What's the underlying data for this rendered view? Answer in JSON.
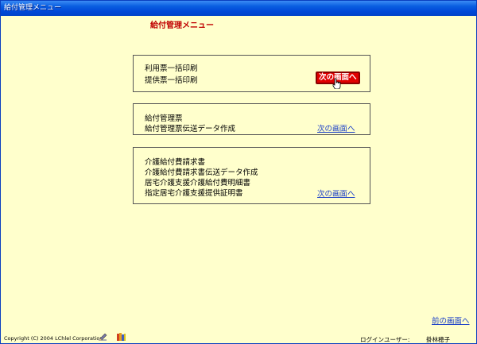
{
  "window": {
    "title": "給付管理メニュー"
  },
  "heading": "給付管理メニュー",
  "panels": [
    {
      "items": [
        "利用票一括印刷",
        "提供票一括印刷"
      ],
      "next_label": "次の画面へ",
      "next_state": "pressed"
    },
    {
      "items": [
        "給付管理票",
        "給付管理票伝送データ作成"
      ],
      "next_label": "次の画面へ",
      "next_state": "normal"
    },
    {
      "items": [
        "介護給付費請求書",
        "介護給付費請求書伝送データ作成",
        "居宅介護支援介護給付費明細書",
        "指定居宅介護支援提供証明書"
      ],
      "next_label": "次の画面へ",
      "next_state": "normal"
    }
  ],
  "back_label": "前の画面へ",
  "footer": {
    "copyright": "Copyright (C) 2004 LChlel Corporation",
    "login_label": "ログインユーザー:",
    "user_name": "掛林穂子"
  },
  "colors": {
    "background": "#ffffcc",
    "heading": "#c00000",
    "link": "#1a3fc8",
    "active_button": "#e00000"
  },
  "icons": [
    "pencil-icon",
    "books-icon",
    "hand-pointer-cursor-icon"
  ]
}
